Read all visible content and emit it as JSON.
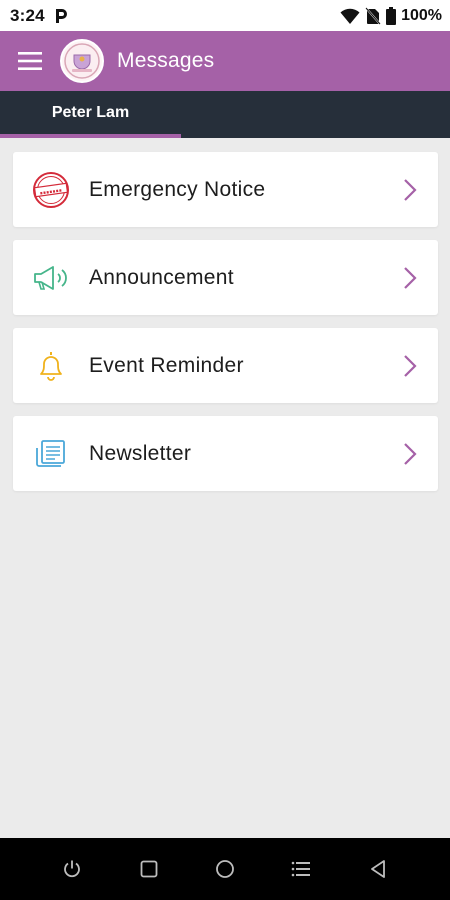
{
  "status_bar": {
    "time": "3:24",
    "battery_text": "100%",
    "icons": [
      "p-icon",
      "wifi-icon",
      "no-sim-icon",
      "battery-icon"
    ]
  },
  "app_bar": {
    "title": "Messages",
    "background": "#a561a7",
    "icons": [
      "menu-icon",
      "school-logo"
    ]
  },
  "tabs": [
    {
      "label": "Peter Lam",
      "selected": true
    }
  ],
  "tab_indicator_color": "#a561a7",
  "list": {
    "items": [
      {
        "label": "Emergency Notice",
        "icon": "urgent-stamp-icon",
        "chevron": "chevron-right-icon"
      },
      {
        "label": "Announcement",
        "icon": "megaphone-icon",
        "chevron": "chevron-right-icon"
      },
      {
        "label": "Event Reminder",
        "icon": "bell-icon",
        "chevron": "chevron-right-icon"
      },
      {
        "label": "Newsletter",
        "icon": "newspaper-icon",
        "chevron": "chevron-right-icon"
      }
    ],
    "accent": "#a561a7"
  },
  "nav_bar": {
    "buttons": [
      "power-icon",
      "recents-icon",
      "home-icon",
      "menu-list-icon",
      "back-icon"
    ]
  }
}
